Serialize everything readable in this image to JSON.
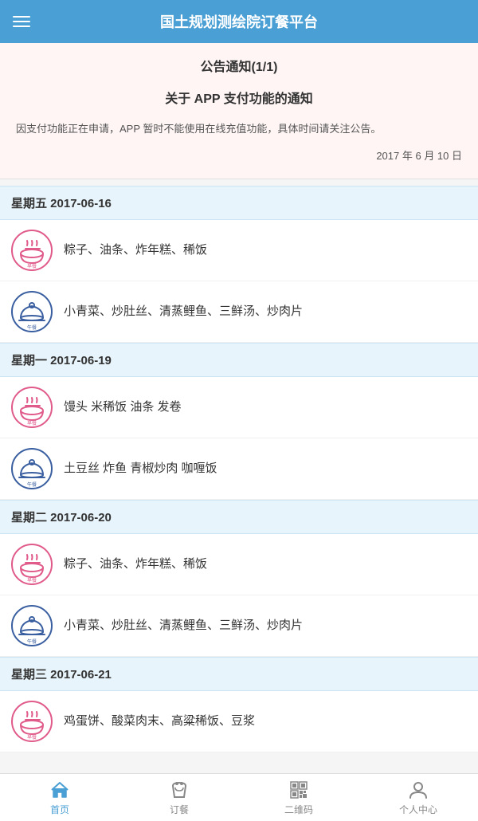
{
  "header": {
    "title": "国土规划测绘院订餐平台",
    "menu_icon": "menu-icon"
  },
  "notice": {
    "title": "公告通知(1/1)",
    "subtitle": "关于 APP 支付功能的通知",
    "body": "因支付功能正在申请，APP 暂时不能使用在线充值功能，具体时间请关注公告。",
    "date": "2017 年 6 月 10 日"
  },
  "menu_days": [
    {
      "day_label": "星期五 2017-06-16",
      "meals": [
        {
          "type": "早餐",
          "items": "粽子、油条、炸年糕、稀饭",
          "icon_type": "breakfast"
        },
        {
          "type": "午餐",
          "items": "小青菜、炒肚丝、清蒸鲤鱼、三鲜汤、炒肉片",
          "icon_type": "lunch"
        }
      ]
    },
    {
      "day_label": "星期一 2017-06-19",
      "meals": [
        {
          "type": "早餐",
          "items": "馒头 米稀饭 油条 发卷",
          "icon_type": "breakfast"
        },
        {
          "type": "午餐",
          "items": "土豆丝 炸鱼 青椒炒肉 咖喱饭",
          "icon_type": "lunch"
        }
      ]
    },
    {
      "day_label": "星期二 2017-06-20",
      "meals": [
        {
          "type": "早餐",
          "items": "粽子、油条、炸年糕、稀饭",
          "icon_type": "breakfast"
        },
        {
          "type": "午餐",
          "items": "小青菜、炒肚丝、清蒸鲤鱼、三鲜汤、炒肉片",
          "icon_type": "lunch"
        }
      ]
    },
    {
      "day_label": "星期三 2017-06-21",
      "meals": [
        {
          "type": "早餐",
          "items": "鸡蛋饼、酸菜肉末、高粱稀饭、豆浆",
          "icon_type": "breakfast"
        }
      ]
    }
  ],
  "bottom_nav": {
    "items": [
      {
        "label": "首页",
        "key": "home",
        "active": true
      },
      {
        "label": "订餐",
        "key": "order",
        "active": false
      },
      {
        "label": "二维码",
        "key": "qrcode",
        "active": false
      },
      {
        "label": "个人中心",
        "key": "profile",
        "active": false
      }
    ]
  }
}
